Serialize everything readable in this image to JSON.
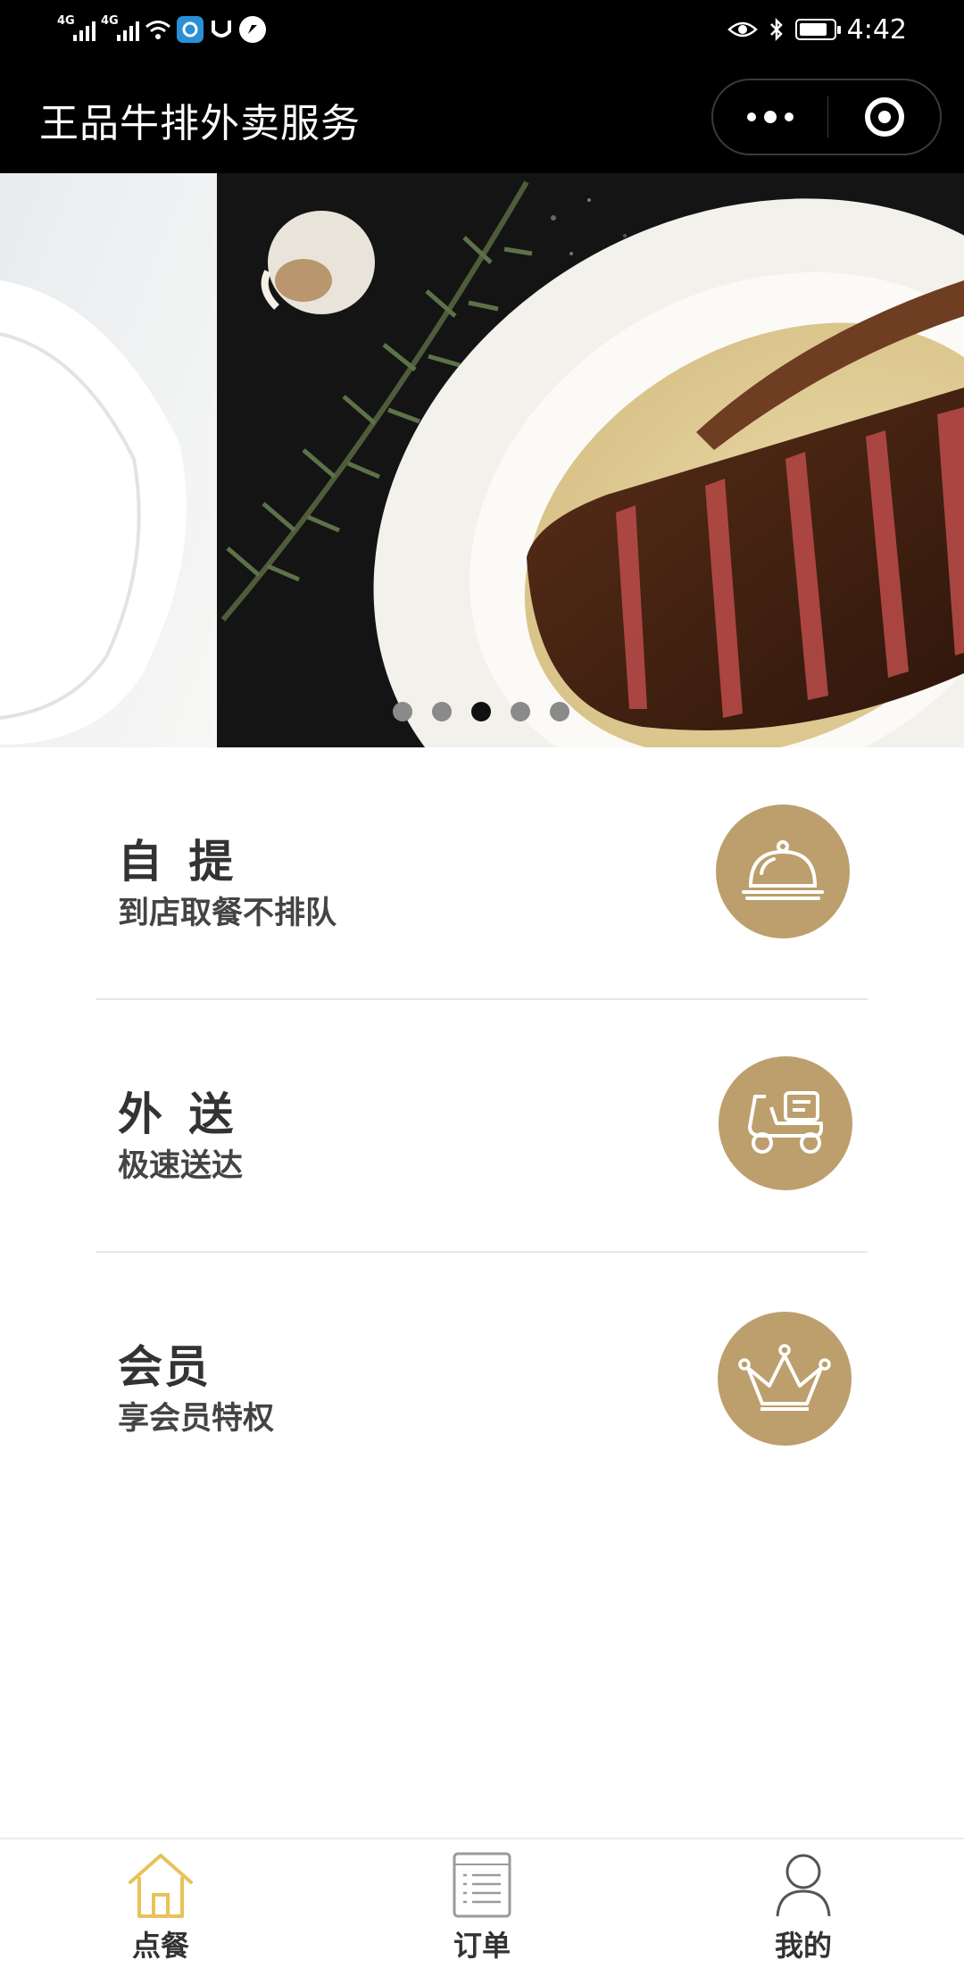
{
  "status_bar": {
    "network_1": "4G",
    "network_2": "4G",
    "time": "4:42",
    "icons": [
      "signal-icon",
      "signal-icon",
      "wifi-icon",
      "app-icon",
      "app-icon",
      "app-icon",
      "eye-icon",
      "bluetooth-icon",
      "battery-icon"
    ]
  },
  "nav": {
    "title": "王品牛排外卖服务",
    "more_icon": "more-dots-icon",
    "close_icon": "target-close-icon"
  },
  "banner": {
    "slide_count": 5,
    "active_index": 2
  },
  "services": [
    {
      "title": "自 提",
      "subtitle": "到店取餐不排队",
      "icon": "cloche-icon"
    },
    {
      "title": "外 送",
      "subtitle": "极速送达",
      "icon": "delivery-scooter-icon"
    },
    {
      "title": "会员",
      "subtitle": "享会员特权",
      "icon": "crown-icon"
    }
  ],
  "tabs": [
    {
      "label": "点餐",
      "icon": "home-icon",
      "active": true
    },
    {
      "label": "订单",
      "icon": "order-list-icon",
      "active": false
    },
    {
      "label": "我的",
      "icon": "user-icon",
      "active": false
    }
  ],
  "colors": {
    "accent_gold": "#bc9f6c",
    "tab_active": "#e8c25a",
    "header_bg": "#000000"
  }
}
